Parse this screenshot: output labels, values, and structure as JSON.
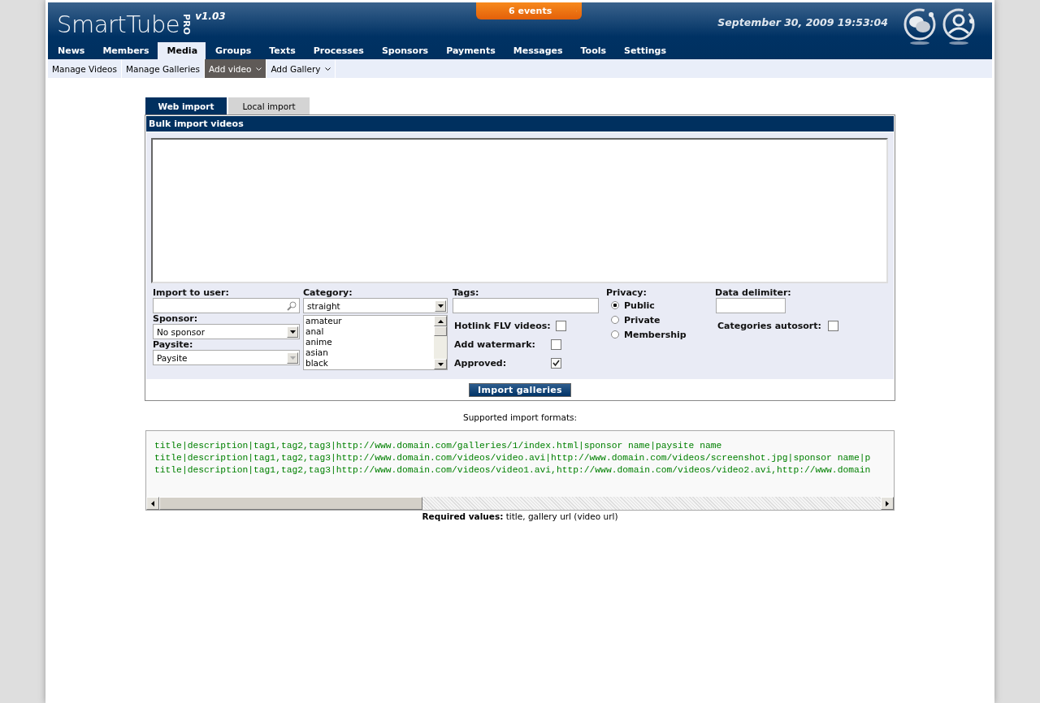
{
  "header": {
    "logo": "SmartTube",
    "logo_badge": "PRO",
    "version": "v1.03",
    "events": "6 events",
    "datetime": "September 30, 2009 19:53:04"
  },
  "nav": [
    {
      "label": "News",
      "selected": false
    },
    {
      "label": "Members",
      "selected": false
    },
    {
      "label": "Media",
      "selected": true
    },
    {
      "label": "Groups",
      "selected": false
    },
    {
      "label": "Texts",
      "selected": false
    },
    {
      "label": "Processes",
      "selected": false
    },
    {
      "label": "Sponsors",
      "selected": false
    },
    {
      "label": "Payments",
      "selected": false
    },
    {
      "label": "Messages",
      "selected": false
    },
    {
      "label": "Tools",
      "selected": false
    },
    {
      "label": "Settings",
      "selected": false
    }
  ],
  "subnav": [
    {
      "label": "Manage Videos",
      "selected": false,
      "dropdown": false
    },
    {
      "label": "Manage Galleries",
      "selected": false,
      "dropdown": false
    },
    {
      "label": "Add video",
      "selected": true,
      "dropdown": true
    },
    {
      "label": "Add Gallery",
      "selected": false,
      "dropdown": true
    }
  ],
  "tabs": [
    {
      "label": "Web import",
      "selected": true
    },
    {
      "label": "Local import",
      "selected": false
    }
  ],
  "panel": {
    "title": "Bulk import videos",
    "import_to_user": {
      "label": "Import to user:"
    },
    "sponsor": {
      "label": "Sponsor:",
      "value": "No sponsor",
      "disabled": false
    },
    "paysite": {
      "label": "Paysite:",
      "value": "Paysite",
      "disabled": true
    },
    "category": {
      "label": "Category:",
      "value": "straight",
      "options": [
        "amateur",
        "anal",
        "anime",
        "asian",
        "black"
      ]
    },
    "tags": {
      "label": "Tags:"
    },
    "checkboxes": [
      {
        "label": "Hotlink FLV videos:",
        "checked": false
      },
      {
        "label": "Add watermark:",
        "checked": false
      },
      {
        "label": "Approved:",
        "checked": true
      }
    ],
    "privacy": {
      "label": "Privacy:",
      "options": [
        {
          "label": "Public",
          "selected": true
        },
        {
          "label": "Private",
          "selected": false
        },
        {
          "label": "Membership",
          "selected": false
        }
      ]
    },
    "data_delimiter": {
      "label": "Data delimiter:"
    },
    "categories_autosort": {
      "label": "Categories autosort:",
      "checked": false
    },
    "button": "Import galleries"
  },
  "formats": {
    "title": "Supported import formats:",
    "lines": [
      "title|description|tag1,tag2,tag3|http://www.domain.com/galleries/1/index.html|sponsor name|paysite name",
      "title|description|tag1,tag2,tag3|http://www.domain.com/videos/video.avi|http://www.domain.com/videos/screenshot.jpg|sponsor name|p",
      "title|description|tag1,tag2,tag3|http://www.domain.com/videos/video1.avi,http://www.domain.com/videos/video2.avi,http://www.domain"
    ],
    "required": "**Required values:** title, gallery url (video url)"
  }
}
